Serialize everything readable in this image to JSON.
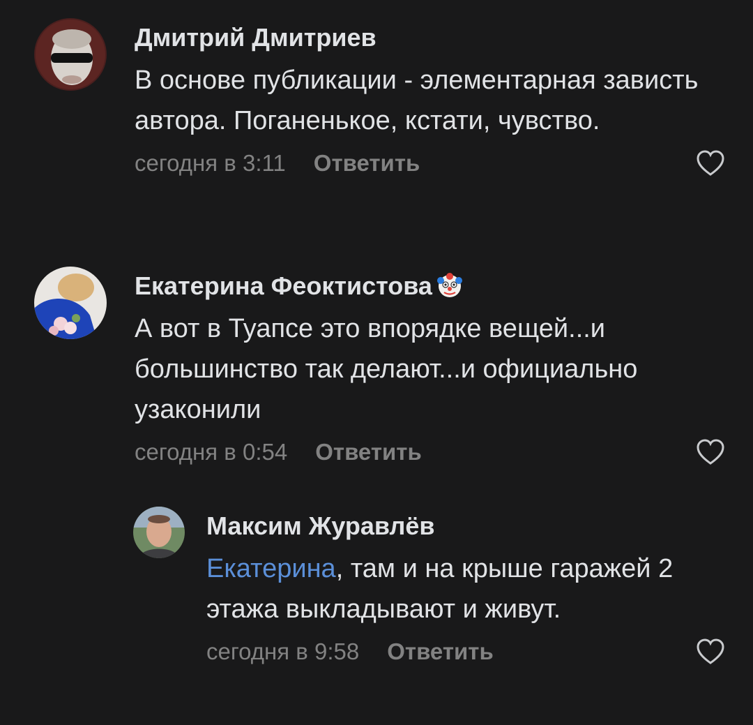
{
  "comments": [
    {
      "author": "Дмитрий Дмитриев",
      "text": "В основе публикации - элементарная зависть автора. Поганенькое, кстати, чувство.",
      "time": "сегодня в 3:11",
      "reply_label": "Ответить",
      "like_icon": "heart-outline-icon"
    },
    {
      "author": "Екатерина Феоктистова",
      "author_emoji": "clown-face-emoji",
      "text": "А вот в Туапсе это впорядке вещей...и большинство так делают...и официально узаконили",
      "time": "сегодня в 0:54",
      "reply_label": "Ответить",
      "like_icon": "heart-outline-icon"
    },
    {
      "author": "Максим Журавлёв",
      "mention": "Екатерина",
      "text": ", там и на крыше гаражей 2 этажа выкладывают и живут.",
      "time": "сегодня в 9:58",
      "reply_label": "Ответить",
      "like_icon": "heart-outline-icon"
    }
  ],
  "colors": {
    "background": "#19191a",
    "text": "#e1e3e6",
    "secondary": "#828282",
    "mention": "#5b8fd8"
  }
}
